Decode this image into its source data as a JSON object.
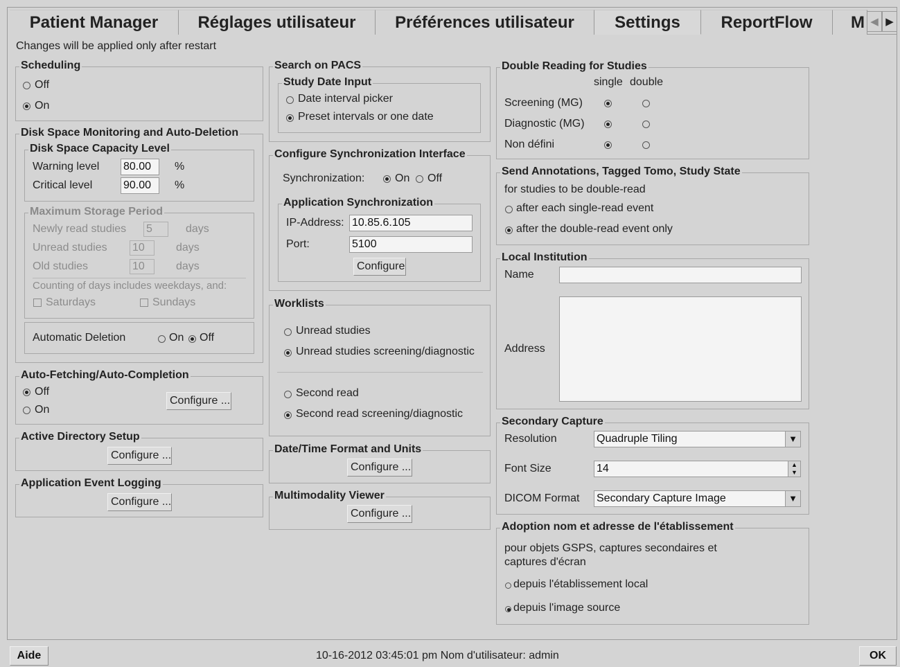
{
  "tabs": [
    "Patient Manager",
    "Réglages utilisateur",
    "Préférences utilisateur",
    "Settings",
    "ReportFlow",
    "M"
  ],
  "active_tab": "Settings",
  "notice": "Changes will be applied only after restart",
  "scheduling": {
    "title": "Scheduling",
    "off": "Off",
    "on": "On"
  },
  "disk": {
    "title": "Disk Space Monitoring and Auto-Deletion",
    "capacity_title": "Disk Space Capacity Level",
    "warning_label": "Warning level",
    "warning_value": "80.00",
    "critical_label": "Critical level",
    "critical_value": "90.00",
    "percent": "%",
    "storage_title": "Maximum Storage Period",
    "newly_label": "Newly read studies",
    "newly_value": "5",
    "unread_label": "Unread studies",
    "unread_value": "10",
    "old_label": "Old studies",
    "old_value": "10",
    "days": "days",
    "counting_note": "Counting of days includes weekdays, and:",
    "saturdays": "Saturdays",
    "sundays": "Sundays",
    "auto_deletion_label": "Automatic Deletion",
    "on": "On",
    "off": "Off"
  },
  "autofetch": {
    "title": "Auto-Fetching/Auto-Completion",
    "off": "Off",
    "on": "On",
    "configure": "Configure ..."
  },
  "active_directory": {
    "title": "Active Directory Setup",
    "configure": "Configure ..."
  },
  "event_logging": {
    "title": "Application Event Logging",
    "configure": "Configure ..."
  },
  "pacs": {
    "title": "Search on PACS",
    "study_date_title": "Study Date Input",
    "interval_picker": "Date interval picker",
    "preset": "Preset intervals or one date"
  },
  "sync": {
    "title": "Configure Synchronization Interface",
    "sync_label": "Synchronization:",
    "on": "On",
    "off": "Off",
    "app_title": "Application Synchronization",
    "ip_label": "IP-Address:",
    "ip_value": "10.85.6.105",
    "port_label": "Port:",
    "port_value": "5100",
    "configure": "Configure"
  },
  "worklists": {
    "title": "Worklists",
    "unread": "Unread studies",
    "unread_sd": "Unread studies screening/diagnostic",
    "second": "Second read",
    "second_sd": "Second read screening/diagnostic"
  },
  "datetime": {
    "title": "Date/Time Format and Units",
    "configure": "Configure ..."
  },
  "multimodality": {
    "title": "Multimodality Viewer",
    "configure": "Configure ..."
  },
  "double_reading": {
    "title": "Double Reading for Studies",
    "col_single": "single",
    "col_double": "double",
    "rows": [
      "Screening (MG)",
      "Diagnostic (MG)",
      "Non défini"
    ]
  },
  "annotations": {
    "title": "Send Annotations, Tagged Tomo, Study State",
    "subtitle": "for studies to be double-read",
    "after_single": "after each single-read event",
    "after_double": "after the double-read event only"
  },
  "institution": {
    "title": "Local Institution",
    "name_label": "Name",
    "address_label": "Address",
    "name_value": "",
    "address_value": ""
  },
  "secondary": {
    "title": "Secondary Capture",
    "resolution_label": "Resolution",
    "resolution_value": "Quadruple Tiling",
    "font_label": "Font Size",
    "font_value": "14",
    "dicom_label": "DICOM Format",
    "dicom_value": "Secondary Capture Image"
  },
  "adoption": {
    "title": "Adoption nom et adresse de l'établissement",
    "desc1": "pour objets GSPS, captures secondaires et",
    "desc2": "captures d'écran",
    "local": "depuis l'établissement local",
    "source": "depuis l'image source"
  },
  "status": {
    "help": "Aide",
    "datetime_user": "10-16-2012  03:45:01 pm  Nom d'utilisateur:  admin",
    "ok": "OK"
  }
}
